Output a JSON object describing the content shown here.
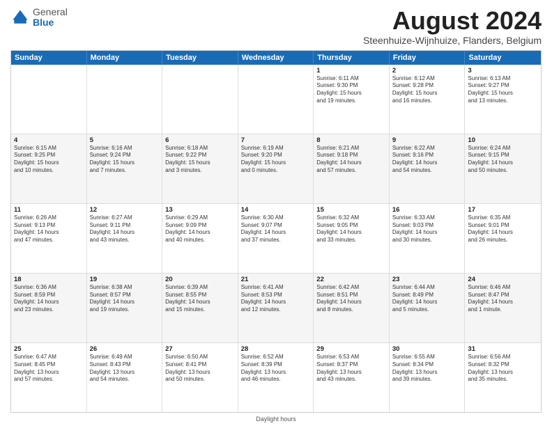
{
  "header": {
    "logo_general": "General",
    "logo_blue": "Blue",
    "month_year": "August 2024",
    "location": "Steenhuize-Wijnhuize, Flanders, Belgium"
  },
  "days_of_week": [
    "Sunday",
    "Monday",
    "Tuesday",
    "Wednesday",
    "Thursday",
    "Friday",
    "Saturday"
  ],
  "footer": "Daylight hours",
  "weeks": [
    [
      {
        "day": "",
        "lines": []
      },
      {
        "day": "",
        "lines": []
      },
      {
        "day": "",
        "lines": []
      },
      {
        "day": "",
        "lines": []
      },
      {
        "day": "1",
        "lines": [
          "Sunrise: 6:11 AM",
          "Sunset: 9:30 PM",
          "Daylight: 15 hours",
          "and 19 minutes."
        ]
      },
      {
        "day": "2",
        "lines": [
          "Sunrise: 6:12 AM",
          "Sunset: 9:28 PM",
          "Daylight: 15 hours",
          "and 16 minutes."
        ]
      },
      {
        "day": "3",
        "lines": [
          "Sunrise: 6:13 AM",
          "Sunset: 9:27 PM",
          "Daylight: 15 hours",
          "and 13 minutes."
        ]
      }
    ],
    [
      {
        "day": "4",
        "lines": [
          "Sunrise: 6:15 AM",
          "Sunset: 9:25 PM",
          "Daylight: 15 hours",
          "and 10 minutes."
        ]
      },
      {
        "day": "5",
        "lines": [
          "Sunrise: 6:16 AM",
          "Sunset: 9:24 PM",
          "Daylight: 15 hours",
          "and 7 minutes."
        ]
      },
      {
        "day": "6",
        "lines": [
          "Sunrise: 6:18 AM",
          "Sunset: 9:22 PM",
          "Daylight: 15 hours",
          "and 3 minutes."
        ]
      },
      {
        "day": "7",
        "lines": [
          "Sunrise: 6:19 AM",
          "Sunset: 9:20 PM",
          "Daylight: 15 hours",
          "and 0 minutes."
        ]
      },
      {
        "day": "8",
        "lines": [
          "Sunrise: 6:21 AM",
          "Sunset: 9:18 PM",
          "Daylight: 14 hours",
          "and 57 minutes."
        ]
      },
      {
        "day": "9",
        "lines": [
          "Sunrise: 6:22 AM",
          "Sunset: 9:16 PM",
          "Daylight: 14 hours",
          "and 54 minutes."
        ]
      },
      {
        "day": "10",
        "lines": [
          "Sunrise: 6:24 AM",
          "Sunset: 9:15 PM",
          "Daylight: 14 hours",
          "and 50 minutes."
        ]
      }
    ],
    [
      {
        "day": "11",
        "lines": [
          "Sunrise: 6:26 AM",
          "Sunset: 9:13 PM",
          "Daylight: 14 hours",
          "and 47 minutes."
        ]
      },
      {
        "day": "12",
        "lines": [
          "Sunrise: 6:27 AM",
          "Sunset: 9:11 PM",
          "Daylight: 14 hours",
          "and 43 minutes."
        ]
      },
      {
        "day": "13",
        "lines": [
          "Sunrise: 6:29 AM",
          "Sunset: 9:09 PM",
          "Daylight: 14 hours",
          "and 40 minutes."
        ]
      },
      {
        "day": "14",
        "lines": [
          "Sunrise: 6:30 AM",
          "Sunset: 9:07 PM",
          "Daylight: 14 hours",
          "and 37 minutes."
        ]
      },
      {
        "day": "15",
        "lines": [
          "Sunrise: 6:32 AM",
          "Sunset: 9:05 PM",
          "Daylight: 14 hours",
          "and 33 minutes."
        ]
      },
      {
        "day": "16",
        "lines": [
          "Sunrise: 6:33 AM",
          "Sunset: 9:03 PM",
          "Daylight: 14 hours",
          "and 30 minutes."
        ]
      },
      {
        "day": "17",
        "lines": [
          "Sunrise: 6:35 AM",
          "Sunset: 9:01 PM",
          "Daylight: 14 hours",
          "and 26 minutes."
        ]
      }
    ],
    [
      {
        "day": "18",
        "lines": [
          "Sunrise: 6:36 AM",
          "Sunset: 8:59 PM",
          "Daylight: 14 hours",
          "and 23 minutes."
        ]
      },
      {
        "day": "19",
        "lines": [
          "Sunrise: 6:38 AM",
          "Sunset: 8:57 PM",
          "Daylight: 14 hours",
          "and 19 minutes."
        ]
      },
      {
        "day": "20",
        "lines": [
          "Sunrise: 6:39 AM",
          "Sunset: 8:55 PM",
          "Daylight: 14 hours",
          "and 15 minutes."
        ]
      },
      {
        "day": "21",
        "lines": [
          "Sunrise: 6:41 AM",
          "Sunset: 8:53 PM",
          "Daylight: 14 hours",
          "and 12 minutes."
        ]
      },
      {
        "day": "22",
        "lines": [
          "Sunrise: 6:42 AM",
          "Sunset: 8:51 PM",
          "Daylight: 14 hours",
          "and 8 minutes."
        ]
      },
      {
        "day": "23",
        "lines": [
          "Sunrise: 6:44 AM",
          "Sunset: 8:49 PM",
          "Daylight: 14 hours",
          "and 5 minutes."
        ]
      },
      {
        "day": "24",
        "lines": [
          "Sunrise: 6:46 AM",
          "Sunset: 8:47 PM",
          "Daylight: 14 hours",
          "and 1 minute."
        ]
      }
    ],
    [
      {
        "day": "25",
        "lines": [
          "Sunrise: 6:47 AM",
          "Sunset: 8:45 PM",
          "Daylight: 13 hours",
          "and 57 minutes."
        ]
      },
      {
        "day": "26",
        "lines": [
          "Sunrise: 6:49 AM",
          "Sunset: 8:43 PM",
          "Daylight: 13 hours",
          "and 54 minutes."
        ]
      },
      {
        "day": "27",
        "lines": [
          "Sunrise: 6:50 AM",
          "Sunset: 8:41 PM",
          "Daylight: 13 hours",
          "and 50 minutes."
        ]
      },
      {
        "day": "28",
        "lines": [
          "Sunrise: 6:52 AM",
          "Sunset: 8:39 PM",
          "Daylight: 13 hours",
          "and 46 minutes."
        ]
      },
      {
        "day": "29",
        "lines": [
          "Sunrise: 6:53 AM",
          "Sunset: 8:37 PM",
          "Daylight: 13 hours",
          "and 43 minutes."
        ]
      },
      {
        "day": "30",
        "lines": [
          "Sunrise: 6:55 AM",
          "Sunset: 8:34 PM",
          "Daylight: 13 hours",
          "and 39 minutes."
        ]
      },
      {
        "day": "31",
        "lines": [
          "Sunrise: 6:56 AM",
          "Sunset: 8:32 PM",
          "Daylight: 13 hours",
          "and 35 minutes."
        ]
      }
    ]
  ]
}
